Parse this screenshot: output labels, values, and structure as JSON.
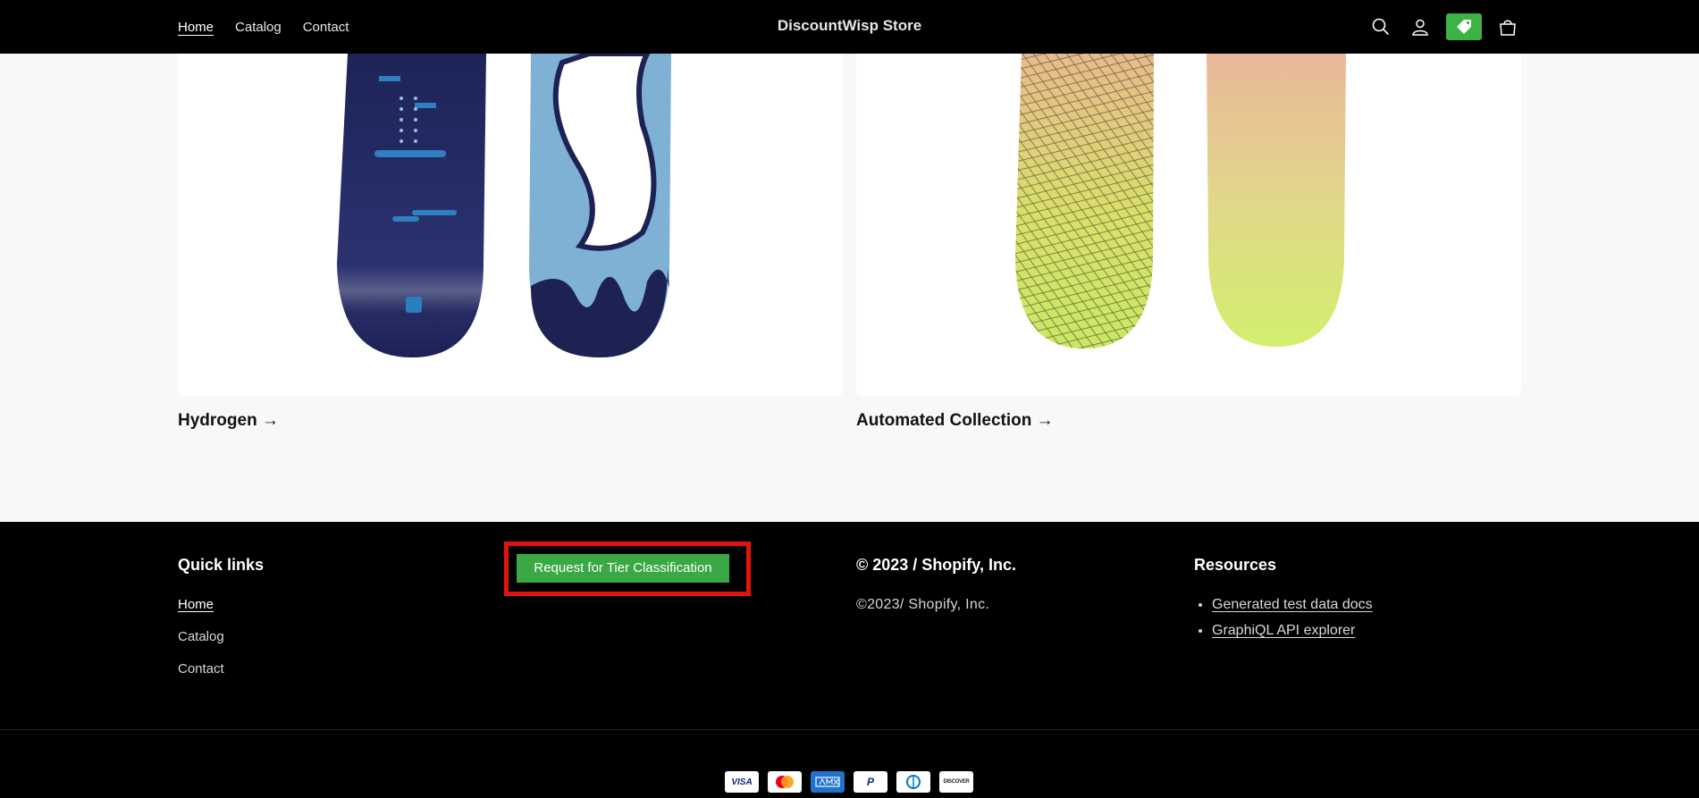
{
  "header": {
    "nav": [
      "Home",
      "Catalog",
      "Contact"
    ],
    "brand": "DiscountWisp Store",
    "icons": [
      "search-icon",
      "account-icon",
      "discount-tag-icon",
      "cart-icon"
    ],
    "tag_color": "#3db245"
  },
  "collections": [
    {
      "title": "Hydrogen",
      "arrow": "→"
    },
    {
      "title": "Automated Collection",
      "arrow": "→"
    }
  ],
  "footer": {
    "quick_links_heading": "Quick links",
    "quick_links": [
      "Home",
      "Catalog",
      "Contact"
    ],
    "tier_button": "Request for Tier Classification",
    "copyright_heading": "© 2023 / Shopify, Inc.",
    "copyright_text": "©2023/ Shopify, Inc.",
    "resources_heading": "Resources",
    "resources": [
      "Generated test data docs",
      "GraphiQL API explorer"
    ],
    "payment_icons": [
      "visa-icon",
      "mastercard-icon",
      "amex-icon",
      "paypal-icon",
      "diners-icon",
      "discover-icon"
    ],
    "payment_labels": {
      "visa": "VISA",
      "paypal": "P",
      "discover": "DISCOVER"
    }
  },
  "colors": {
    "accent_green": "#3aa845",
    "highlight_red": "#e3140f"
  }
}
